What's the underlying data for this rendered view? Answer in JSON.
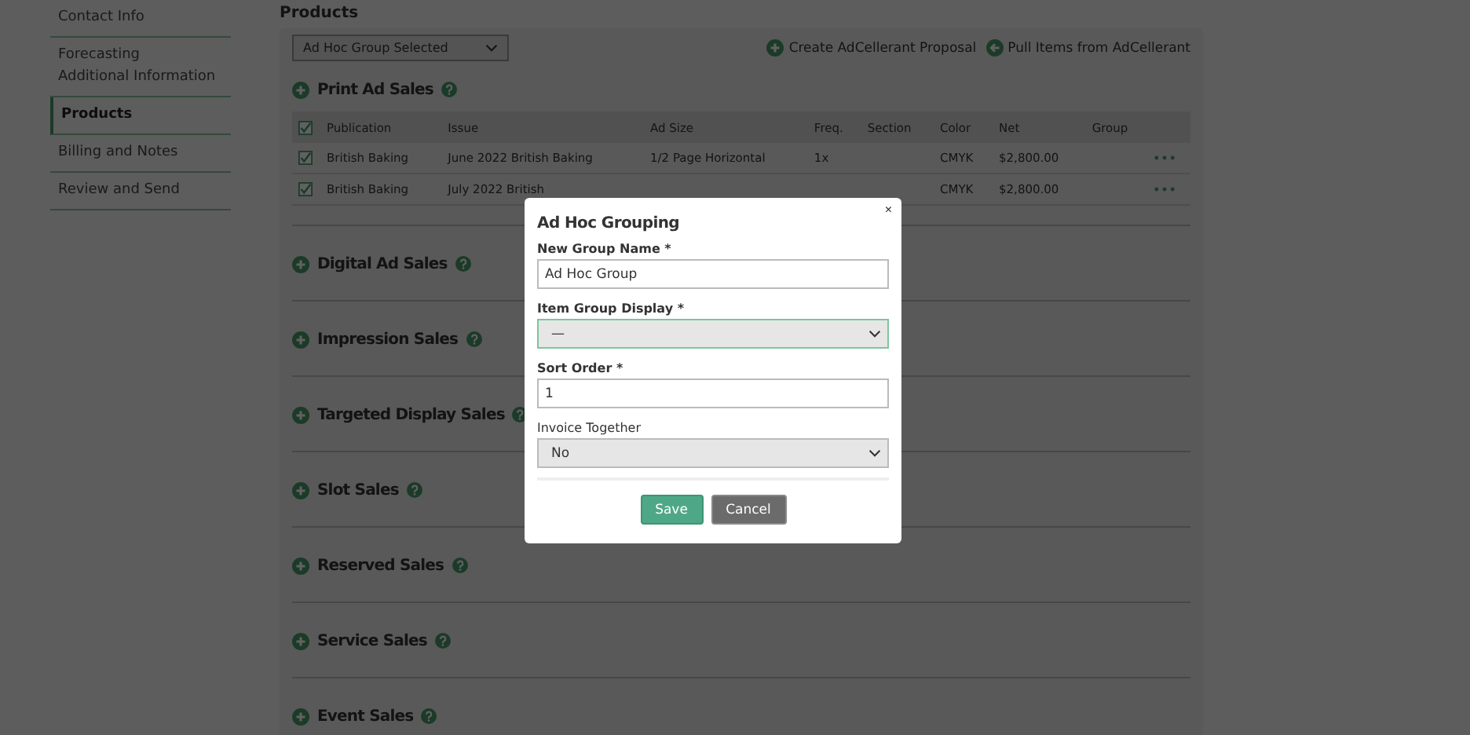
{
  "sidebar": {
    "items": [
      {
        "label": "Contact Info",
        "selected": false
      },
      {
        "label": "Forecasting\nAdditional Information",
        "selected": false
      },
      {
        "label": "Products",
        "selected": true
      },
      {
        "label": "Billing and Notes",
        "selected": false
      },
      {
        "label": "Review and Send",
        "selected": false
      }
    ]
  },
  "products": {
    "title": "Products",
    "group_select": "Ad Hoc Group Selected",
    "actions": [
      {
        "label": "Create AdCellerant Proposal",
        "kind": "add"
      },
      {
        "label": "Pull Items from AdCellerant",
        "kind": "back"
      }
    ],
    "sections": [
      {
        "title": "Print Ad Sales",
        "table": {
          "header_checked": true,
          "columns": [
            "Publication",
            "Issue",
            "Ad Size",
            "Freq.",
            "Section",
            "Color",
            "Net",
            "Group"
          ],
          "rows": [
            {
              "checked": true,
              "cells": [
                "British Baking",
                "June 2022 British Baking",
                "1/2 Page Horizontal",
                "1x",
                "",
                "CMYK",
                "$2,800.00",
                ""
              ]
            },
            {
              "checked": true,
              "cells": [
                "British Baking",
                "July 2022 British",
                "",
                "",
                "",
                "CMYK",
                "$2,800.00",
                ""
              ]
            }
          ]
        }
      },
      {
        "title": "Digital Ad Sales"
      },
      {
        "title": "Impression Sales"
      },
      {
        "title": "Targeted Display Sales"
      },
      {
        "title": "Slot Sales"
      },
      {
        "title": "Reserved Sales"
      },
      {
        "title": "Service Sales"
      },
      {
        "title": "Event Sales"
      }
    ]
  },
  "dialog": {
    "title": "Ad Hoc Grouping",
    "close": "×",
    "fields": [
      {
        "label": "New Group Name *",
        "kind": "text",
        "value": "Ad Hoc Group",
        "focused": false,
        "bold": true
      },
      {
        "label": "Item Group Display *",
        "kind": "select",
        "value": "—",
        "focused": true,
        "bold": true
      },
      {
        "label": "Sort Order *",
        "kind": "text",
        "value": "1",
        "focused": false,
        "bold": true
      },
      {
        "label": "Invoice Together",
        "kind": "select",
        "value": "No",
        "focused": false,
        "bold": false
      }
    ],
    "buttons": [
      {
        "label": "Save",
        "kind": "primary"
      },
      {
        "label": "Cancel",
        "kind": "secondary"
      }
    ]
  }
}
